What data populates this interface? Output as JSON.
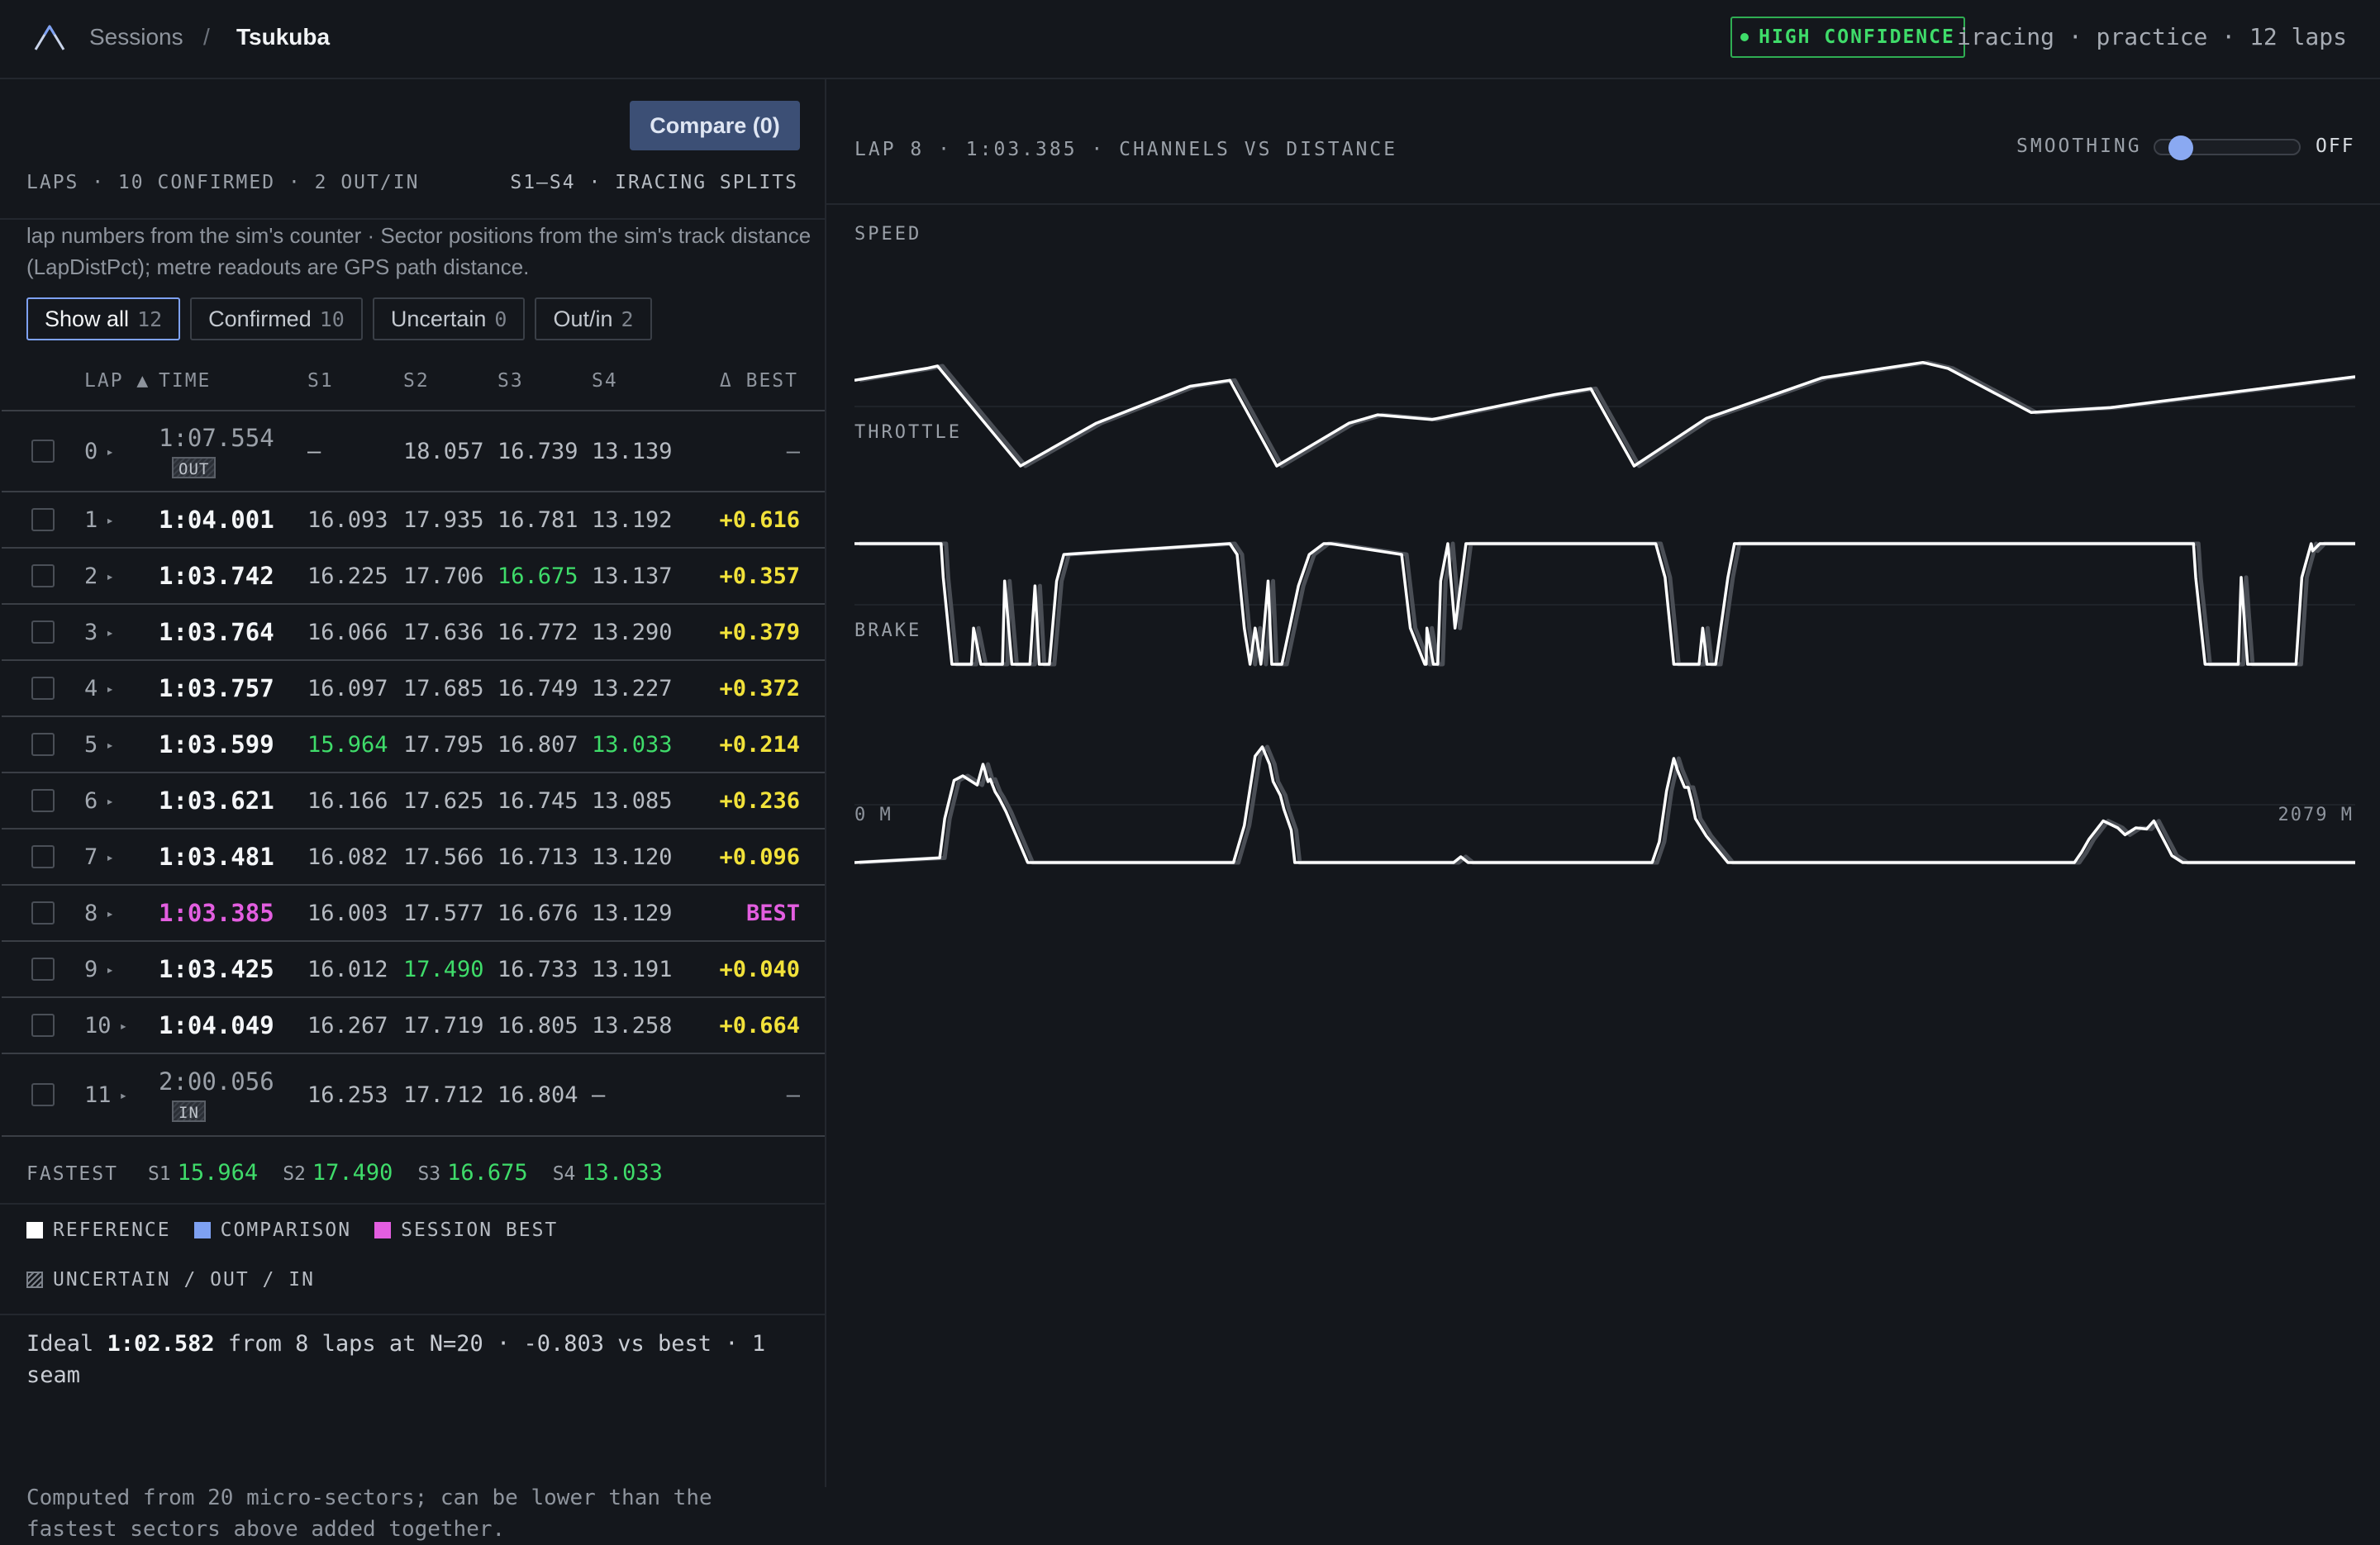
{
  "header": {
    "breadcrumb": [
      "Sessions",
      "/",
      "Tsukuba"
    ],
    "confidence": "HIGH CONFIDENCE",
    "meta": "iracing · practice · 12 laps"
  },
  "left": {
    "compare_label": "Compare (0)",
    "laps_heading": "LAPS · 10 CONFIRMED · 2 OUT/IN",
    "splits_heading": "S1–S4 · IRACING SPLITS",
    "note": "lap numbers from the sim's counter · Sector positions from the sim's track distance (LapDistPct); metre readouts are GPS path distance.",
    "filters": [
      {
        "label": "Show all",
        "count": "12"
      },
      {
        "label": "Confirmed",
        "count": "10"
      },
      {
        "label": "Uncertain",
        "count": "0"
      },
      {
        "label": "Out/in",
        "count": "2"
      }
    ],
    "columns": {
      "lap": "LAP ▲",
      "time": "TIME",
      "s1": "S1",
      "s2": "S2",
      "s3": "S3",
      "s4": "S4",
      "delta": "Δ BEST"
    },
    "laps": [
      {
        "lap": "0",
        "time": "1:07.554",
        "tag": "OUT",
        "s1": "—",
        "s2": "18.057",
        "s3": "16.739",
        "s4": "13.139",
        "delta": "—"
      },
      {
        "lap": "1",
        "time": "1:04.001",
        "s1": "16.093",
        "s2": "17.935",
        "s3": "16.781",
        "s4": "13.192",
        "delta": "+0.616"
      },
      {
        "lap": "2",
        "time": "1:03.742",
        "s1": "16.225",
        "s2": "17.706",
        "s3": "16.675",
        "s4": "13.137",
        "delta": "+0.357"
      },
      {
        "lap": "3",
        "time": "1:03.764",
        "s1": "16.066",
        "s2": "17.636",
        "s3": "16.772",
        "s4": "13.290",
        "delta": "+0.379"
      },
      {
        "lap": "4",
        "time": "1:03.757",
        "s1": "16.097",
        "s2": "17.685",
        "s3": "16.749",
        "s4": "13.227",
        "delta": "+0.372"
      },
      {
        "lap": "5",
        "time": "1:03.599",
        "s1": "15.964",
        "s2": "17.795",
        "s3": "16.807",
        "s4": "13.033",
        "delta": "+0.214"
      },
      {
        "lap": "6",
        "time": "1:03.621",
        "s1": "16.166",
        "s2": "17.625",
        "s3": "16.745",
        "s4": "13.085",
        "delta": "+0.236"
      },
      {
        "lap": "7",
        "time": "1:03.481",
        "s1": "16.082",
        "s2": "17.566",
        "s3": "16.713",
        "s4": "13.120",
        "delta": "+0.096"
      },
      {
        "lap": "8",
        "time": "1:03.385",
        "s1": "16.003",
        "s2": "17.577",
        "s3": "16.676",
        "s4": "13.129",
        "delta": "BEST"
      },
      {
        "lap": "9",
        "time": "1:03.425",
        "s1": "16.012",
        "s2": "17.490",
        "s3": "16.733",
        "s4": "13.191",
        "delta": "+0.040"
      },
      {
        "lap": "10",
        "time": "1:04.049",
        "s1": "16.267",
        "s2": "17.719",
        "s3": "16.805",
        "s4": "13.258",
        "delta": "+0.664"
      },
      {
        "lap": "11",
        "time": "2:00.056",
        "tag": "IN",
        "s1": "16.253",
        "s2": "17.712",
        "s3": "16.804",
        "s4": "—",
        "delta": "—"
      }
    ],
    "fastest": {
      "label": "FASTEST",
      "s1": "15.964",
      "s2": "17.490",
      "s3": "16.675",
      "s4": "13.033"
    },
    "legend": [
      "REFERENCE",
      "COMPARISON",
      "SESSION BEST",
      "UNCERTAIN / OUT / IN"
    ],
    "ideal_prefix": "Ideal",
    "ideal_time": "1:02.582",
    "ideal_suffix": "from 8 laps at N=20 · -0.803 vs best · 1 seam",
    "ideal_note": "Computed from 20 micro-sectors; can be lower than the fastest sectors above added together."
  },
  "right": {
    "title": "LAP 8 · 1:03.385 · CHANNELS VS DISTANCE",
    "smoothing_label": "SMOOTHING",
    "smoothing_value": "OFF",
    "smoothing_level": 0.1,
    "axis_start": "0 M",
    "axis_end": "2079 M"
  },
  "colors": {
    "accent": "#7ea1f2",
    "fastest": "#3fdc6a",
    "session_best": "#e35ee0",
    "delta": "#f2e23a",
    "reference": "#ffffff",
    "comparison": "#7ea1f2"
  },
  "icons": {
    "logo": "mountain-logo-icon",
    "expand": "chevron-right-icon"
  },
  "chart_data": [
    {
      "type": "line",
      "title": "SPEED",
      "xlim": [
        0,
        2079
      ],
      "series": [
        {
          "x": [
            0,
            100,
            115,
            230,
            335,
            465,
            520,
            585,
            685,
            725,
            800,
            970,
            1020,
            1080,
            1180,
            1340,
            1480,
            1515,
            1630,
            1740,
            2079
          ],
          "y": [
            0.72,
            0.82,
            0.84,
            0.0,
            0.36,
            0.67,
            0.72,
            0.0,
            0.36,
            0.43,
            0.39,
            0.6,
            0.65,
            0.0,
            0.4,
            0.74,
            0.87,
            0.82,
            0.45,
            0.49,
            0.75
          ]
        }
      ]
    },
    {
      "type": "line",
      "title": "THROTTLE",
      "xlim": [
        0,
        2079
      ],
      "series": [
        {
          "x": [
            0,
            120,
            123,
            135,
            162,
            165,
            175,
            205,
            208,
            218,
            243,
            250,
            256,
            260,
            270,
            280,
            290,
            520,
            530,
            540,
            548,
            555,
            563,
            573,
            578,
            592,
            615,
            630,
            650,
            660,
            758,
            770,
            790,
            792,
            793,
            802,
            805,
            808,
            812,
            822,
            832,
            847,
            878,
            890,
            1110,
            1123,
            1130,
            1135,
            1170,
            1175,
            1181,
            1193,
            1210,
            1219,
            1285,
            1320,
            1855,
            1858,
            1871,
            1917,
            1921,
            1930,
            1935,
            1997,
            2005,
            2018,
            2020,
            2030,
            2079
          ],
          "y": [
            1,
            1,
            0.72,
            0,
            0,
            0.3,
            0,
            0,
            0.69,
            0,
            0,
            0.65,
            0,
            0,
            0,
            0.69,
            0.91,
            1,
            0.91,
            0.3,
            0,
            0.3,
            0,
            0.69,
            0,
            0,
            0.65,
            0.91,
            1,
            1,
            0.91,
            0.3,
            0,
            0,
            0.3,
            0,
            0,
            0,
            0.69,
            1,
            0.3,
            1,
            1,
            1,
            1,
            0.72,
            0.3,
            0,
            0,
            0.3,
            0,
            0,
            0.72,
            1,
            1,
            1,
            1,
            0.72,
            0,
            0,
            0.72,
            0,
            0,
            0,
            0.72,
            1,
            0.94,
            1,
            1
          ]
        }
      ]
    },
    {
      "type": "line",
      "title": "BRAKE",
      "xlim": [
        0,
        2079
      ],
      "series": [
        {
          "x": [
            0,
            118,
            125,
            138,
            150,
            170,
            178,
            185,
            188,
            195,
            200,
            210,
            240,
            525,
            540,
            555,
            565,
            575,
            580,
            590,
            595,
            605,
            610,
            830,
            840,
            850,
            1105,
            1115,
            1125,
            1135,
            1140,
            1150,
            1155,
            1160,
            1165,
            1180,
            1210,
            1690,
            1700,
            1710,
            1730,
            1750,
            1760,
            1775,
            1790,
            1800,
            1810,
            1820,
            1825,
            1840,
            1850,
            1857,
            2079
          ],
          "y": [
            0,
            0.04,
            0.38,
            0.71,
            0.75,
            0.67,
            0.85,
            0.7,
            0.72,
            0.61,
            0.56,
            0.44,
            0,
            0,
            0.32,
            0.92,
            1.0,
            0.85,
            0.7,
            0.58,
            0.46,
            0.28,
            0,
            0,
            0.05,
            0,
            0,
            0.18,
            0.62,
            0.9,
            0.8,
            0.65,
            0.65,
            0.53,
            0.38,
            0.23,
            0,
            0,
            0.09,
            0.2,
            0.36,
            0.3,
            0.24,
            0.3,
            0.29,
            0.36,
            0.24,
            0.12,
            0.06,
            0,
            0,
            0,
            0
          ]
        }
      ]
    }
  ]
}
